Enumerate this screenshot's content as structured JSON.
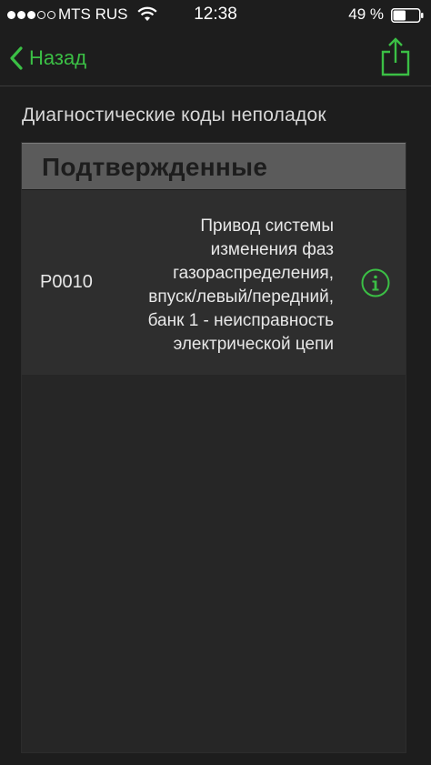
{
  "status_bar": {
    "carrier": "MTS RUS",
    "time": "12:38",
    "battery": "49 %",
    "battery_level": 0.49,
    "signal_bars": 3,
    "signal_total": 5
  },
  "nav": {
    "back_label": "Назад",
    "accent_color": "#3bbf45"
  },
  "page": {
    "section_title": "Диагностические коды неполадок"
  },
  "panel": {
    "header": "Подтвержденные",
    "codes": [
      {
        "code": "P0010",
        "description": "Привод системы\nизменения фаз\nгазораспределения,\nвпуск/левый/передний,\nбанк 1 - неисправность\nэлектрической цепи",
        "icon": "info-icon"
      }
    ]
  }
}
